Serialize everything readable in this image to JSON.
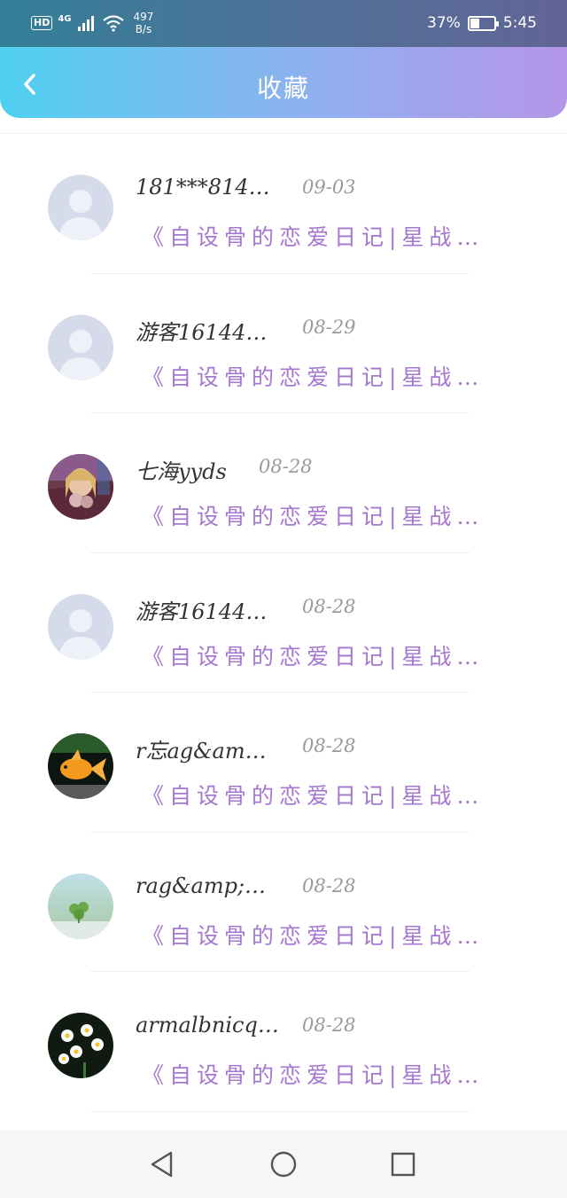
{
  "status_bar": {
    "hd": "HD",
    "network": "4G",
    "speed_value": "497",
    "speed_unit": "B/s",
    "battery_percent": "37%",
    "battery_level": 0.37,
    "time": "5:45"
  },
  "header": {
    "title": "收藏",
    "back_icon": "chevron-left-icon"
  },
  "colors": {
    "header_gradient_start": "#4fd0f0",
    "header_gradient_end": "#b596e8",
    "novel_text": "#a578d0",
    "date_text": "#9a9a9a"
  },
  "items": [
    {
      "name": "181***814…",
      "date": "09-03",
      "novel": "《自设骨的恋爱日记|星战…",
      "avatar": "default-avatar"
    },
    {
      "name": "游客16144…",
      "date": "08-29",
      "novel": "《自设骨的恋爱日记|星战…",
      "avatar": "default-avatar"
    },
    {
      "name": "七海yyds",
      "date": "08-28",
      "novel": "《自设骨的恋爱日记|星战…",
      "avatar": "anime-girl-avatar"
    },
    {
      "name": "游客16144…",
      "date": "08-28",
      "novel": "《自设骨的恋爱日记|星战…",
      "avatar": "default-avatar"
    },
    {
      "name": "r忘ag&am…",
      "date": "08-28",
      "novel": "《自设骨的恋爱日记|星战…",
      "avatar": "goldfish-avatar"
    },
    {
      "name": "rag&amp;…",
      "date": "08-28",
      "novel": "《自设骨的恋爱日记|星战…",
      "avatar": "clover-avatar"
    },
    {
      "name": "armalbnicq…",
      "date": "08-28",
      "novel": "《自设骨的恋爱日记|星战…",
      "avatar": "flowers-avatar"
    }
  ],
  "nav": {
    "back": "triangle-back-icon",
    "home": "circle-home-icon",
    "recent": "square-recent-icon"
  }
}
